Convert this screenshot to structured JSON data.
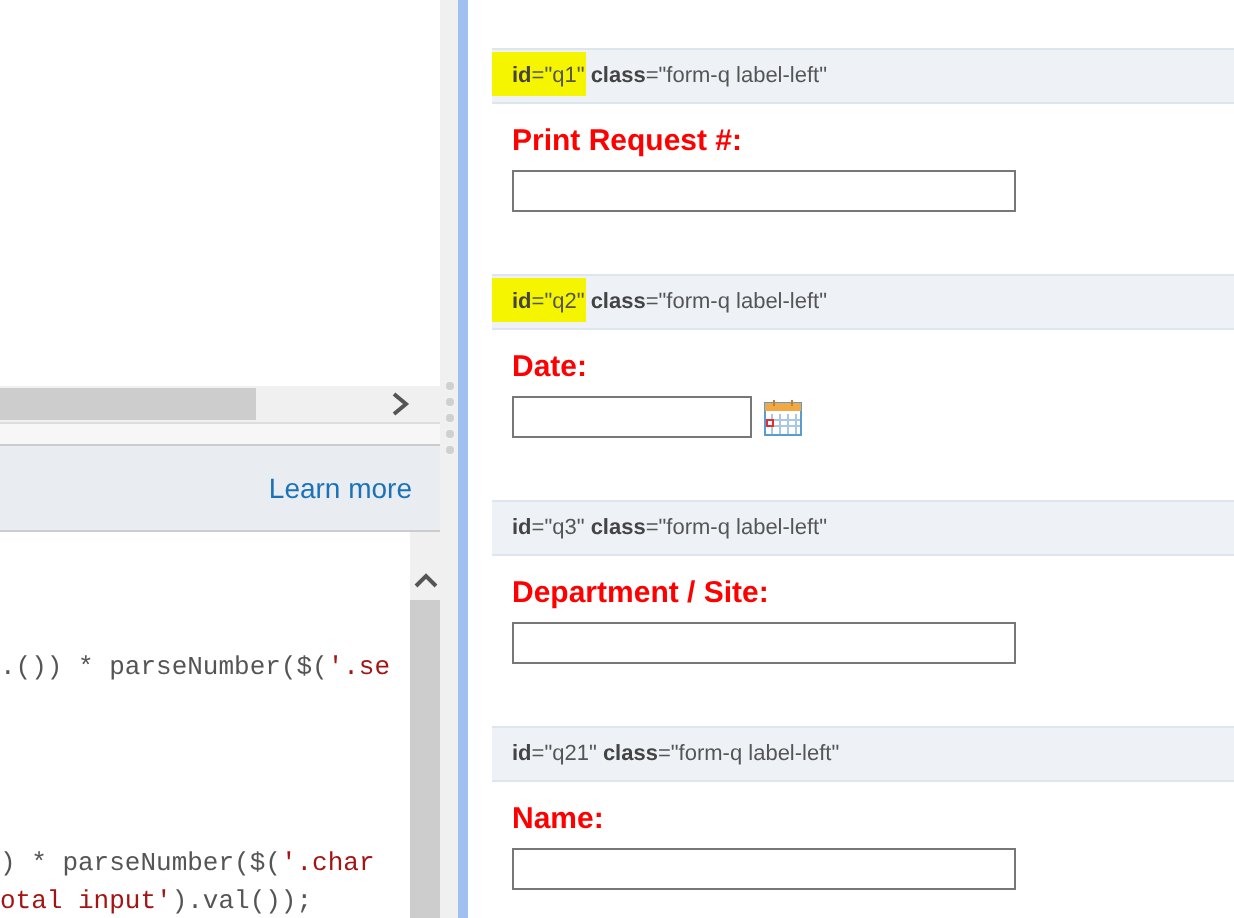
{
  "info_bar": {
    "link": "Learn more"
  },
  "code_lines": [
    {
      "segments": [
        {
          "kind": "plain",
          "text": ".()) * parseNumber($("
        },
        {
          "kind": "string",
          "text": "'.se"
        }
      ]
    },
    {
      "segments": [
        {
          "kind": "plain",
          "text": ") * parseNumber($("
        },
        {
          "kind": "string",
          "text": "'.char"
        }
      ]
    },
    {
      "segments": [
        {
          "kind": "string",
          "text": "otal input'"
        },
        {
          "kind": "plain",
          "text": ").val());"
        }
      ]
    }
  ],
  "questions": [
    {
      "header": "**id**=\"q1\" **class**=\"form-q label-left\"",
      "highlighted": true,
      "label": "Print Request #:",
      "kind": "text"
    },
    {
      "header": "**id**=\"q2\" **class**=\"form-q label-left\"",
      "highlighted": true,
      "label": "Date:",
      "kind": "date"
    },
    {
      "header": "**id**=\"q3\" **class**=\"form-q label-left\"",
      "highlighted": false,
      "label": "Department / Site:",
      "kind": "text"
    },
    {
      "header": "**id**=\"q21\" **class**=\"form-q label-left\"",
      "highlighted": false,
      "label": "Name:",
      "kind": "text"
    }
  ]
}
